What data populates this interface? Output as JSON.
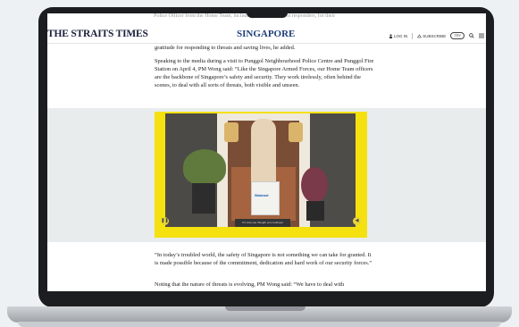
{
  "header": {
    "cutoff_text": "Police Officer from the Home Team, including officers and first responders, for their",
    "logo": "THE STRAITS TIMES",
    "section": "SINGAPORE",
    "login_label": "LOG IN",
    "subscribe_label": "SUBSCRIBE",
    "pill_label": "TRY"
  },
  "article": {
    "p1": "gratitude for responding to threats and saving lives, he added.",
    "p2": "Speaking to the media during a visit to Punggol Neighbourhood Police Centre and Punggol Fire Station on April 4, PM Wong said: “Like the Singapore Armed Forces, our Home Team officers are the backbone of Singapore’s safety and security. They work tirelessly, often behind the scenes, to deal with all sorts of threats, both visible and unseen.",
    "p3": "“In today’s troubled world, the safety of Singapore is not something we can take for granted. It is made possible because of the commitment, dedication and hard work of our security forces.”",
    "p4": "Noting that the nature of threats is evolving, PM Wong said: “We have to deal with"
  },
  "video": {
    "bag_text": "Walmart",
    "mat_text": "It's cute you thought you could get",
    "play_icon": "pause-icon",
    "sound_icon": "speaker-icon"
  },
  "colors": {
    "logo": "#1b1f3b",
    "section": "#1f3f7a",
    "video_bg": "#f5e10f"
  }
}
